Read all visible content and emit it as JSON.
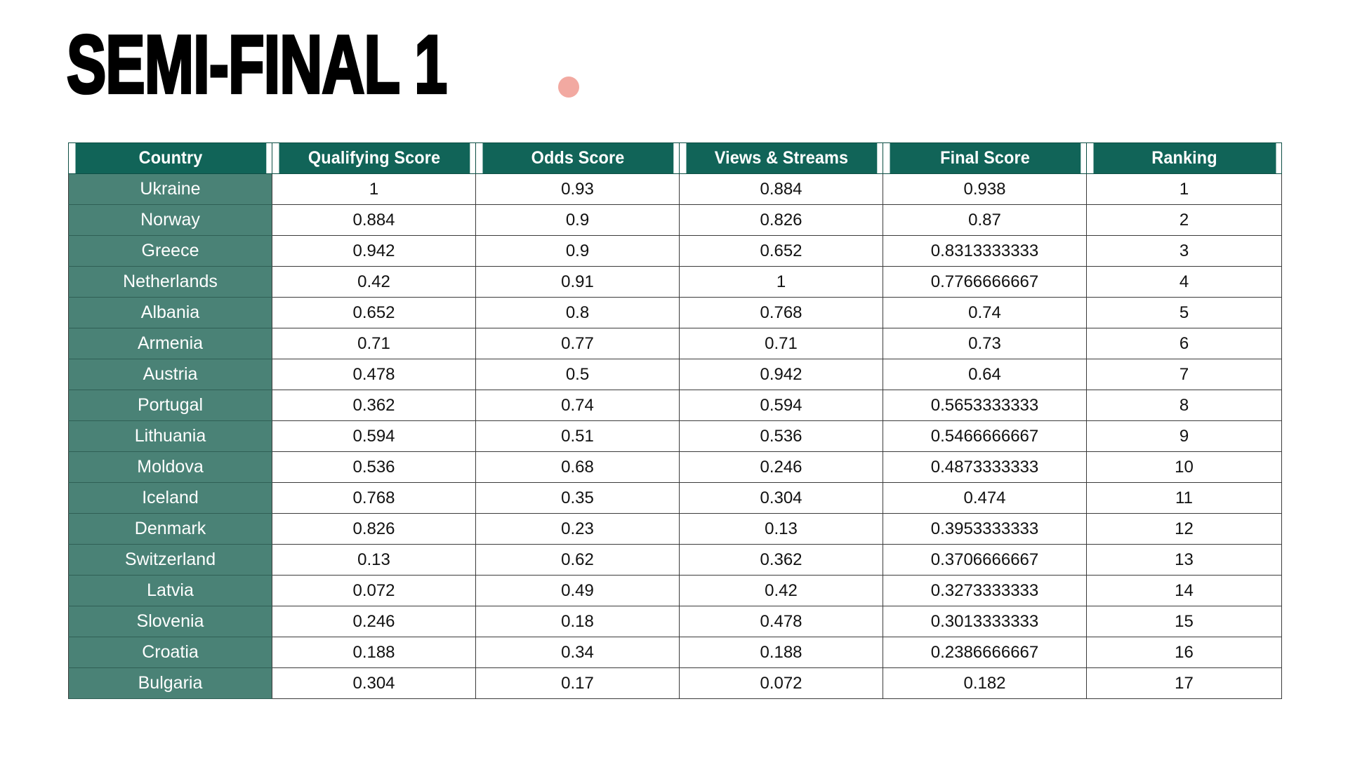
{
  "title": {
    "text": "SEMI-FINAL 1",
    "dot_color": "#f2a9a1"
  },
  "colors": {
    "header_bg": "#116458",
    "country_bg": "#4a8276",
    "header_text": "#ffffff",
    "cell_text": "#111111",
    "grid_line": "#3b3b3b",
    "accent_pink": "#f2a9a1"
  },
  "table": {
    "columns": [
      "Country",
      "Qualifying Score",
      "Odds Score",
      "Views & Streams",
      "Final Score",
      "Ranking"
    ],
    "rows": [
      [
        "Ukraine",
        "1",
        "0.93",
        "0.884",
        "0.938",
        "1"
      ],
      [
        "Norway",
        "0.884",
        "0.9",
        "0.826",
        "0.87",
        "2"
      ],
      [
        "Greece",
        "0.942",
        "0.9",
        "0.652",
        "0.8313333333",
        "3"
      ],
      [
        "Netherlands",
        "0.42",
        "0.91",
        "1",
        "0.7766666667",
        "4"
      ],
      [
        "Albania",
        "0.652",
        "0.8",
        "0.768",
        "0.74",
        "5"
      ],
      [
        "Armenia",
        "0.71",
        "0.77",
        "0.71",
        "0.73",
        "6"
      ],
      [
        "Austria",
        "0.478",
        "0.5",
        "0.942",
        "0.64",
        "7"
      ],
      [
        "Portugal",
        "0.362",
        "0.74",
        "0.594",
        "0.5653333333",
        "8"
      ],
      [
        "Lithuania",
        "0.594",
        "0.51",
        "0.536",
        "0.5466666667",
        "9"
      ],
      [
        "Moldova",
        "0.536",
        "0.68",
        "0.246",
        "0.4873333333",
        "10"
      ],
      [
        "Iceland",
        "0.768",
        "0.35",
        "0.304",
        "0.474",
        "11"
      ],
      [
        "Denmark",
        "0.826",
        "0.23",
        "0.13",
        "0.3953333333",
        "12"
      ],
      [
        "Switzerland",
        "0.13",
        "0.62",
        "0.362",
        "0.3706666667",
        "13"
      ],
      [
        "Latvia",
        "0.072",
        "0.49",
        "0.42",
        "0.3273333333",
        "14"
      ],
      [
        "Slovenia",
        "0.246",
        "0.18",
        "0.478",
        "0.3013333333",
        "15"
      ],
      [
        "Croatia",
        "0.188",
        "0.34",
        "0.188",
        "0.2386666667",
        "16"
      ],
      [
        "Bulgaria",
        "0.304",
        "0.17",
        "0.072",
        "0.182",
        "17"
      ]
    ]
  }
}
